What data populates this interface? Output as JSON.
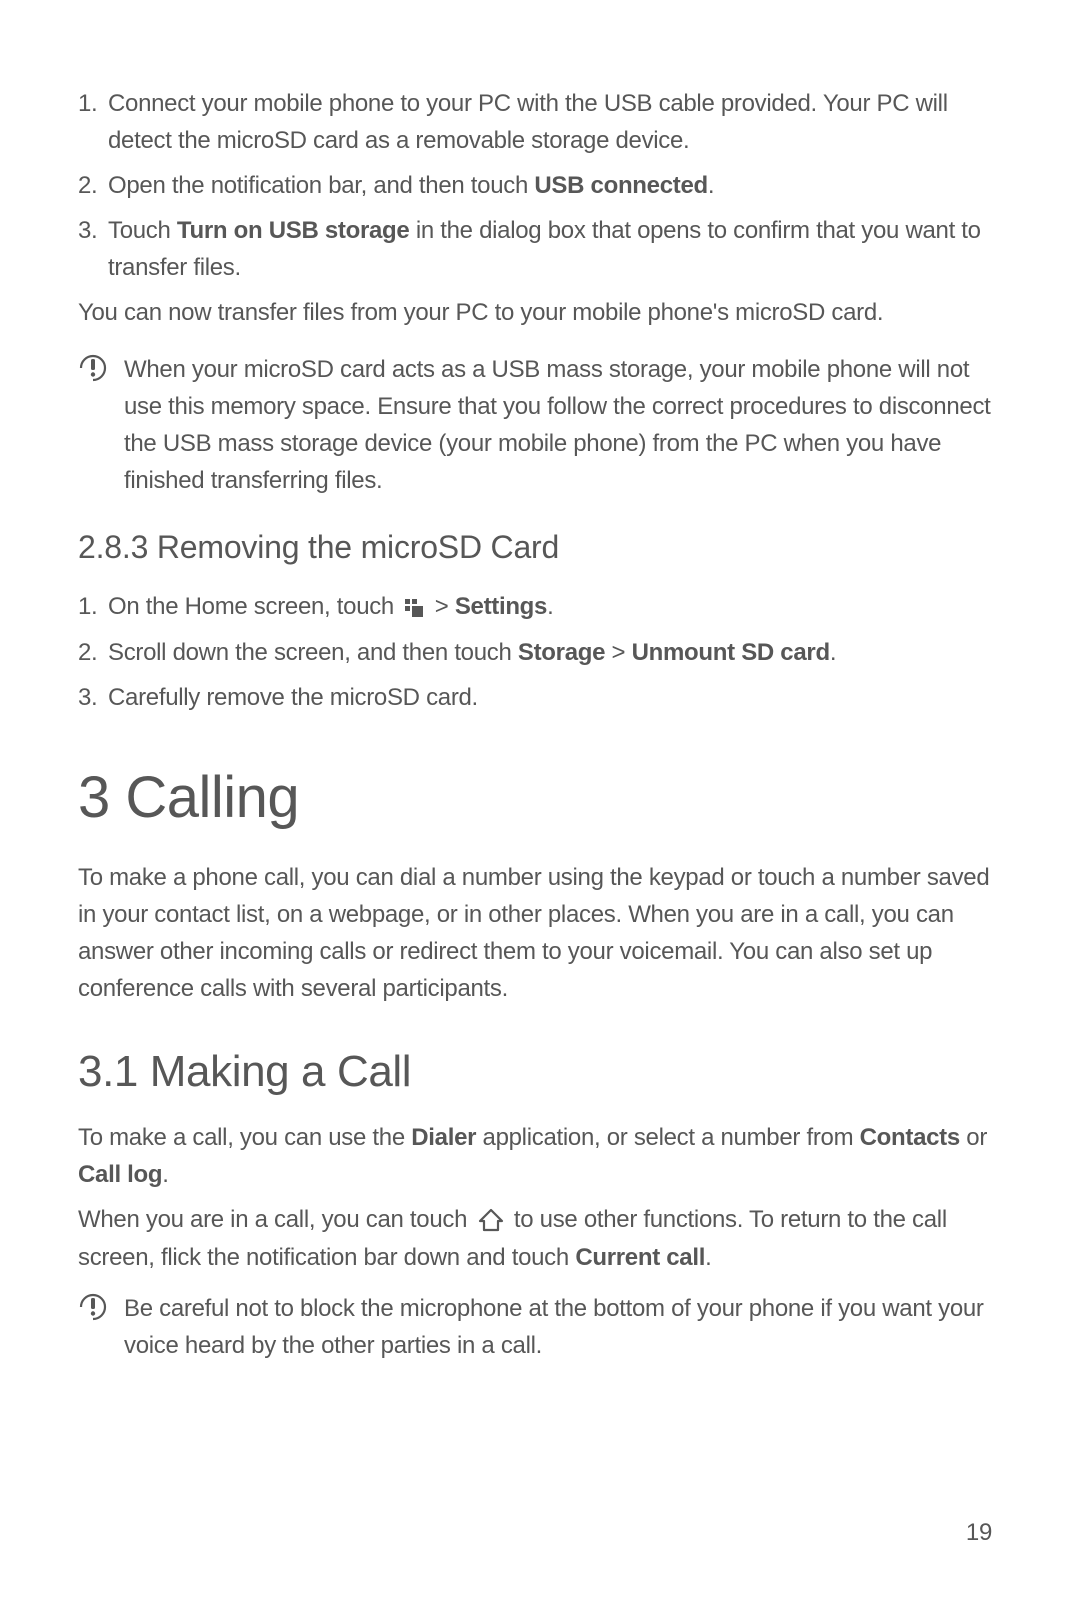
{
  "step1_num": "1.",
  "step1_text": "Connect your mobile phone to your PC with the USB cable provided. Your PC will detect the microSD card as a removable storage device.",
  "step2_num": "2.",
  "step2_pre": "Open the notification bar, and then touch ",
  "step2_bold": "USB connected",
  "step2_post": ".",
  "step3_num": "3.",
  "step3_pre": "Touch ",
  "step3_bold": "Turn on USB storage",
  "step3_post": " in the dialog box that opens to confirm that you want to transfer files.",
  "transfer_para": "You can now transfer files from your PC to your mobile phone's microSD card.",
  "note1": "When your microSD card acts as a USB mass storage, your mobile phone will not use this memory space. Ensure that you follow the correct procedures to disconnect the USB mass storage device (your mobile phone) from the PC when you have finished transferring files.",
  "section283": "2.8.3  Removing the microSD Card",
  "rm1_num": "1.",
  "rm1_pre": "On the Home screen, touch ",
  "rm1_mid": "  > ",
  "rm1_bold": "Settings",
  "rm1_post": ".",
  "rm2_num": "2.",
  "rm2_pre": "Scroll down the screen, and then touch ",
  "rm2_bold1": "Storage",
  "rm2_mid": " > ",
  "rm2_bold2": "Unmount SD card",
  "rm2_post": ".",
  "rm3_num": "3.",
  "rm3_text": "Carefully remove the microSD card.",
  "chapter3": "3  Calling",
  "calling_intro": "To make a phone call, you can dial a number using the keypad or touch a number saved in your contact list, on a webpage, or in other places. When you are in a call, you can answer other incoming calls or redirect them to your voicemail. You can also set up conference calls with several participants.",
  "section31": "3.1  Making a Call",
  "mk_para1_pre": "To make a call, you can use the ",
  "mk_para1_b1": "Dialer",
  "mk_para1_mid1": " application, or select a number from ",
  "mk_para1_b2": "Contacts",
  "mk_para1_mid2": " or ",
  "mk_para1_b3": "Call log",
  "mk_para1_post": ".",
  "mk_para2_pre": "When you are in a call, you can touch ",
  "mk_para2_mid": " to use other functions. To return to the call screen, flick the notification bar down and touch ",
  "mk_para2_b1": "Current call",
  "mk_para2_post": ".",
  "note2": "Be careful not to block the microphone at the bottom of your phone if you want your voice heard by the other parties in a call.",
  "page_number": "19"
}
